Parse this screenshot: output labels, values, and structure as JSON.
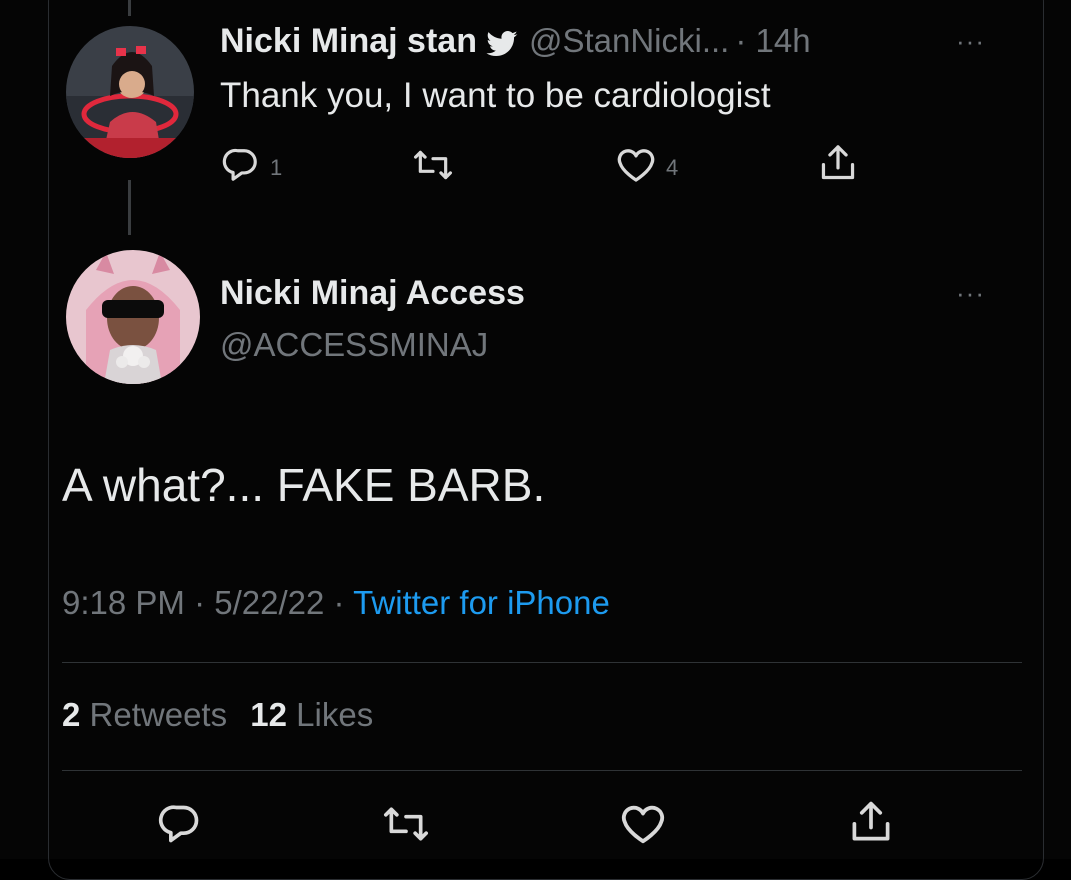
{
  "reply_tweet": {
    "name": "Nicki Minaj stan",
    "handle": "@StanNicki...",
    "time": "· 14h",
    "more": "···",
    "text": "Thank you, I want to be cardiologist",
    "reply_count": "1",
    "retweet_count": "",
    "like_count": "4"
  },
  "main_tweet": {
    "name": "Nicki Minaj Access",
    "handle": "@ACCESSMINAJ",
    "more": "···",
    "text": "A what?... FAKE BARB.",
    "timestamp": "9:18 PM · 5/22/22 · ",
    "source": "Twitter for iPhone",
    "retweets_num": "2",
    "retweets_label": "Retweets",
    "likes_num": "12",
    "likes_label": "Likes"
  },
  "icons": {
    "verified": "verified-badge-icon",
    "reply": "reply-icon",
    "retweet": "retweet-icon",
    "like": "heart-icon",
    "share": "share-icon"
  },
  "colors": {
    "background": "#000000",
    "text": "#e7e9ea",
    "secondary": "#71767b",
    "accent": "#1d9bf0"
  }
}
